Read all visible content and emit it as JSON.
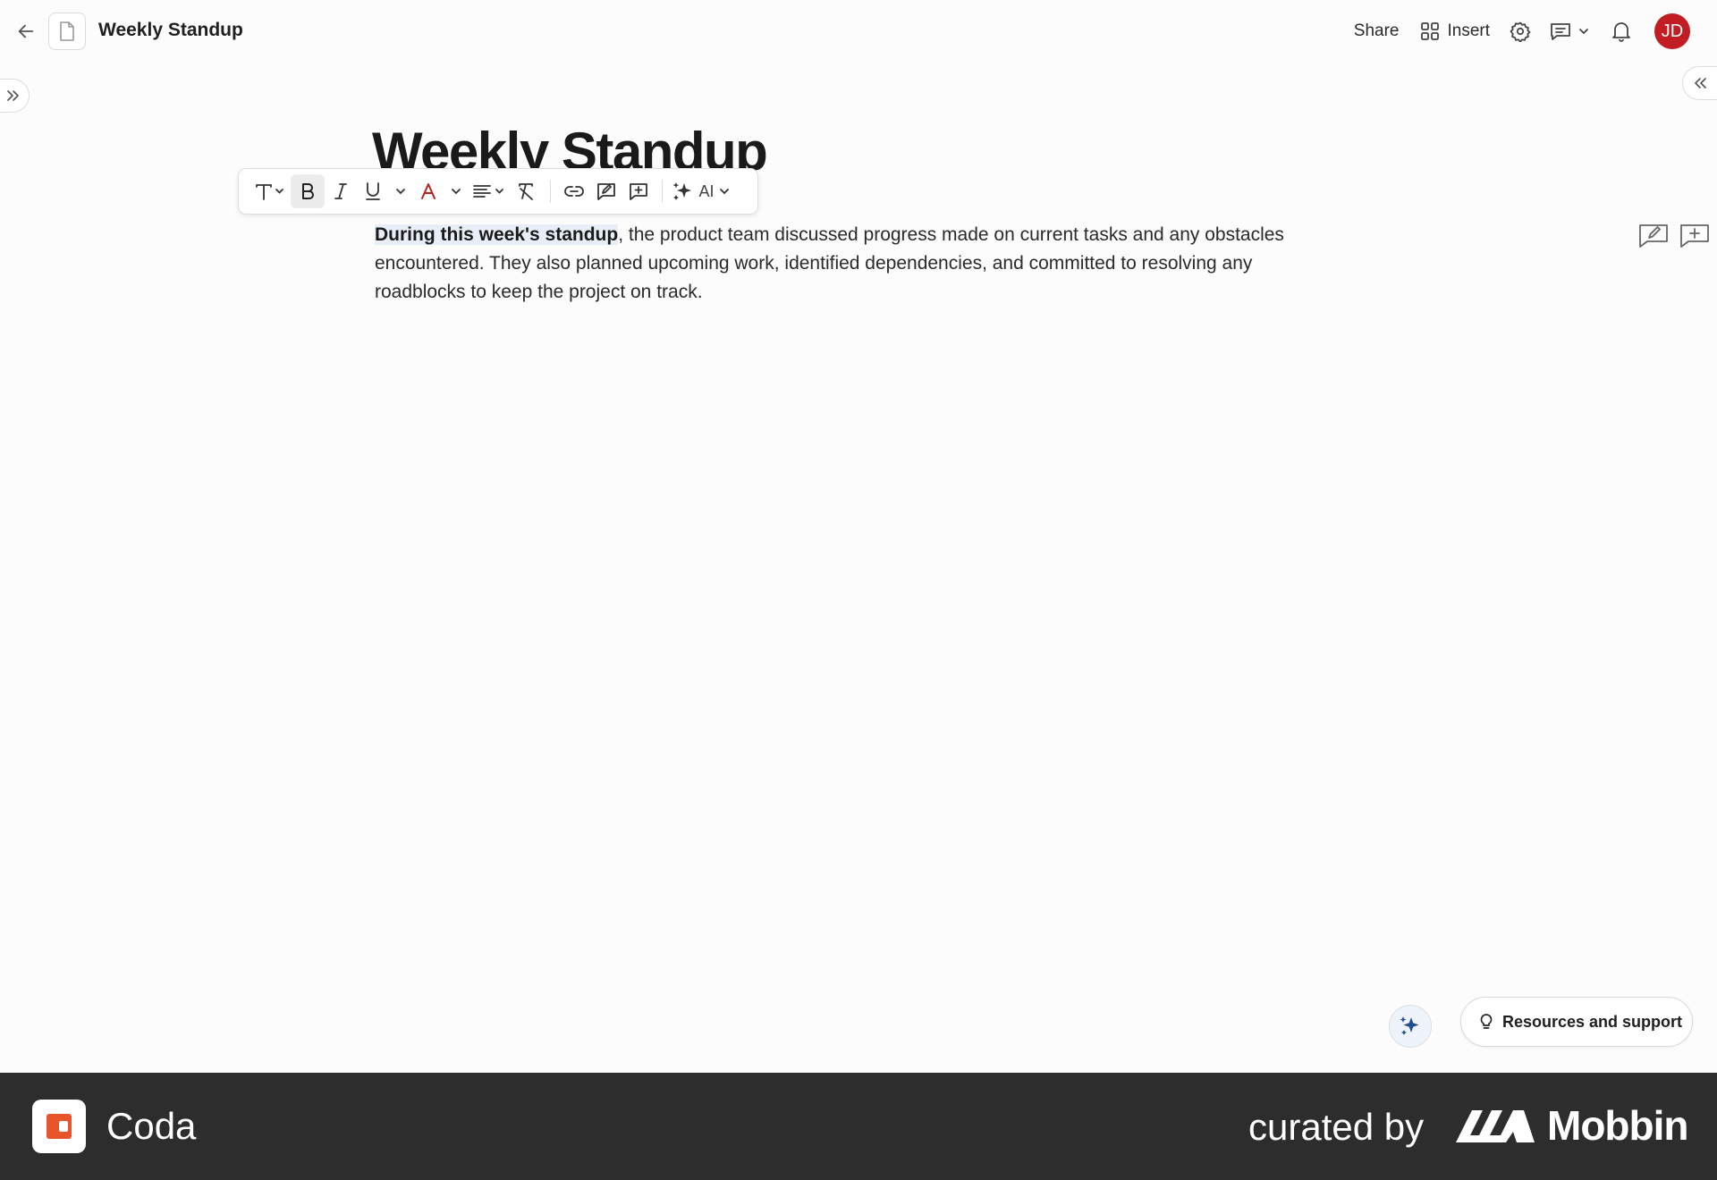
{
  "topbar": {
    "title": "Weekly Standup",
    "share_label": "Share",
    "insert_label": "Insert",
    "avatar_initials": "JD",
    "avatar_color": "#c21d22"
  },
  "document": {
    "heading": "Weekly Standup",
    "paragraph": {
      "highlighted": "During this week's standup",
      "rest": ", the product team discussed progress made on current tasks and any obstacles encountered. They also planned upcoming work, identified dependencies, and committed to resolving any roadblocks to keep the project on track."
    }
  },
  "toolbar": {
    "active_format": "bold",
    "ai_label": "AI",
    "text_color": "#b3261e",
    "icons": [
      "text-style-icon",
      "bold-icon",
      "italic-icon",
      "underline-icon",
      "text-color-icon",
      "align-icon",
      "clear-format-icon",
      "link-icon",
      "comment-icon",
      "add-icon",
      "ai-sparkle-icon"
    ]
  },
  "support": {
    "resources_label": "Resources and support"
  },
  "footer": {
    "brand": "Coda",
    "brand_color": "#e8552b",
    "curated_label": "curated by",
    "curator": "Mobbin"
  }
}
